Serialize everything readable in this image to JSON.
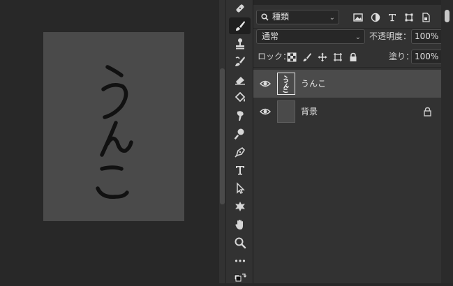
{
  "canvas": {
    "document_text": "うんこ",
    "background_color": "#4a4a4a"
  },
  "toolbar": {
    "tools": [
      {
        "name": "healing-brush-icon",
        "active": false
      },
      {
        "name": "brush-icon",
        "active": true
      },
      {
        "name": "clone-stamp-icon",
        "active": false
      },
      {
        "name": "history-brush-icon",
        "active": false
      },
      {
        "name": "eraser-icon",
        "active": false
      },
      {
        "name": "paint-bucket-icon",
        "active": false
      },
      {
        "name": "smudge-icon",
        "active": false
      },
      {
        "name": "dodge-icon",
        "active": false
      },
      {
        "name": "pen-icon",
        "active": false
      },
      {
        "name": "type-icon",
        "active": false
      },
      {
        "name": "path-selection-icon",
        "active": false
      },
      {
        "name": "custom-shape-icon",
        "active": false
      },
      {
        "name": "hand-icon",
        "active": false
      },
      {
        "name": "zoom-icon",
        "active": false
      },
      {
        "name": "more-tools-icon",
        "active": false
      },
      {
        "name": "swap-colors-icon",
        "active": false
      }
    ]
  },
  "layers_panel": {
    "filter_kind_label": "種類",
    "blend_mode": "通常",
    "opacity_label": "不透明度：",
    "opacity_value": "100%",
    "lock_label": "ロック：",
    "fill_label": "塗り：",
    "fill_value": "100%",
    "layers": [
      {
        "name": "うんこ",
        "selected": true,
        "visible": true,
        "locked": false
      },
      {
        "name": "背景",
        "selected": false,
        "visible": true,
        "locked": true
      }
    ]
  }
}
